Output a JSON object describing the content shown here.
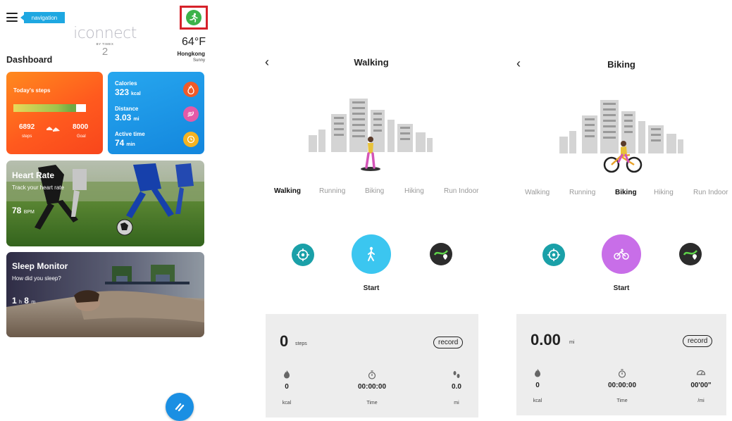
{
  "dashboard": {
    "nav_label": "navigation",
    "logo_text": "iconnect",
    "logo_brand": "BY TIMEX",
    "logo_version": "2",
    "temperature": "64°F",
    "city": "Hongkong",
    "condition": "Sunny",
    "title": "Dashboard",
    "steps": {
      "label": "Today's steps",
      "value": "6892",
      "value_label": "steps",
      "goal": "8000",
      "goal_label": "Goal",
      "progress": 0.86
    },
    "stats": [
      {
        "label": "Calories",
        "value": "323",
        "unit": "kcal",
        "icon": "flame-icon",
        "color": "#f05a28"
      },
      {
        "label": "Distance",
        "value": "3.03",
        "unit": "mi",
        "icon": "running-icon",
        "color": "#e45aa8"
      },
      {
        "label": "Active time",
        "value": "74",
        "unit": "min",
        "icon": "clock-icon",
        "color": "#f5b321"
      }
    ],
    "heart_rate": {
      "title": "Heart Rate",
      "subtitle": "Track your heart rate",
      "value": "78",
      "unit": "BPM"
    },
    "sleep": {
      "title": "Sleep Monitor",
      "subtitle": "How did you sleep?",
      "hours": "1",
      "h_unit": "h",
      "minutes": "8",
      "m_unit": "m"
    }
  },
  "walking": {
    "title": "Walking",
    "tabs": [
      "Walking",
      "Running",
      "Biking",
      "Hiking",
      "Run Indoor"
    ],
    "active_tab": 0,
    "start_label": "Start",
    "start_color": "#3bc6f0",
    "main_value": "0",
    "main_unit": "steps",
    "record_label": "record",
    "metrics": [
      {
        "value": "0",
        "label": "kcal",
        "icon": "flame-icon"
      },
      {
        "value": "00:00:00",
        "label": "Time",
        "icon": "stopwatch-icon"
      },
      {
        "value": "0.0",
        "label": "mi",
        "icon": "footprints-icon"
      }
    ]
  },
  "biking": {
    "title": "Biking",
    "tabs": [
      "Walking",
      "Running",
      "Biking",
      "Hiking",
      "Run Indoor"
    ],
    "active_tab": 2,
    "start_label": "Start",
    "start_color": "#c86ee8",
    "main_value": "0.00",
    "main_unit": "mi",
    "record_label": "record",
    "metrics": [
      {
        "value": "0",
        "label": "kcal",
        "icon": "flame-icon"
      },
      {
        "value": "00:00:00",
        "label": "Time",
        "icon": "stopwatch-icon"
      },
      {
        "value": "00'00\"",
        "label": "/mi",
        "icon": "speedometer-icon"
      }
    ]
  }
}
